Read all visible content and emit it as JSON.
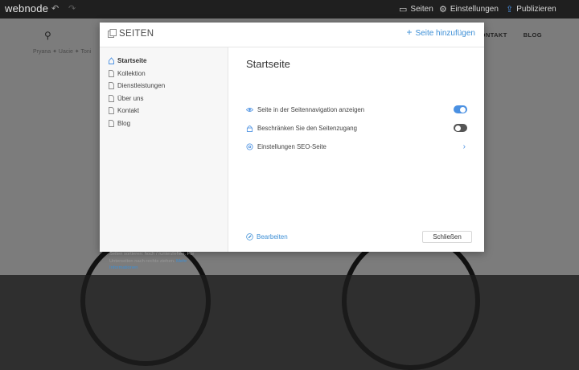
{
  "topbar": {
    "logo": "webnode",
    "pages_label": "Seiten",
    "settings_label": "Einstellungen",
    "publish_label": "Publizieren"
  },
  "site": {
    "nav": [
      "KONTAKT",
      "BLOG"
    ],
    "breadcrumb": "Pryana ✦ Uacie ✦ Toni"
  },
  "modal": {
    "title": "SEITEN",
    "add_page": "Seite hinzufügen",
    "pages": [
      {
        "label": "Startseite",
        "active": true,
        "icon": "home-icon"
      },
      {
        "label": "Kollektion",
        "active": false,
        "icon": "page-icon"
      },
      {
        "label": "Dienstleistungen",
        "active": false,
        "icon": "page-icon"
      },
      {
        "label": "Über uns",
        "active": false,
        "icon": "page-icon"
      },
      {
        "label": "Kontakt",
        "active": false,
        "icon": "page-icon"
      },
      {
        "label": "Blog",
        "active": false,
        "icon": "page-icon"
      }
    ],
    "hint_text": "Seiten sortieren: hoch / runterziehen. Für Unterseiten nach rechts ziehen.",
    "hint_link": "Mehr Informationen",
    "content": {
      "title": "Startseite",
      "show_in_nav": {
        "label": "Seite in der Seitennavigation anzeigen",
        "enabled": true,
        "icon": "eye-icon"
      },
      "restrict_access": {
        "label": "Beschränken Sie den Seitenzugang",
        "enabled": false,
        "icon": "lock-icon"
      },
      "seo": {
        "label": "Einstellungen SEO-Seite",
        "icon": "seo-icon"
      },
      "edit_label": "Bearbeiten",
      "close_label": "Schließen"
    }
  },
  "colors": {
    "accent": "#4a90e2",
    "link": "#3d8fd6",
    "toggle_off": "#555555"
  }
}
